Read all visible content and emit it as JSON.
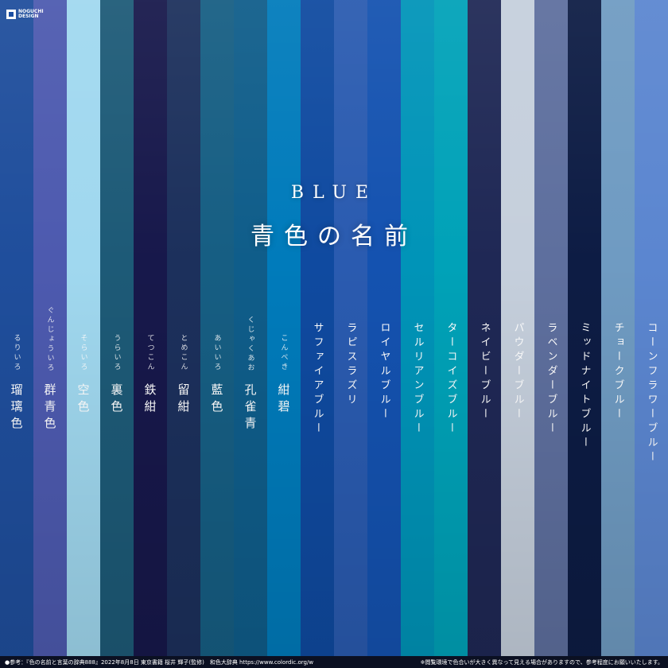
{
  "logo": {
    "line1": "NOGUCHI",
    "line2": "DESIGN"
  },
  "title": {
    "en": "BLUE",
    "jp": "青色の名前"
  },
  "colors": [
    {
      "name": "瑠璃色",
      "ruby": "るりいろ",
      "hex": "#1f4e9c",
      "kind": "kanji"
    },
    {
      "name": "群青色",
      "ruby": "ぐんじょういろ",
      "hex": "#4d5aaf",
      "kind": "kanji"
    },
    {
      "name": "空色",
      "ruby": "そらいろ",
      "hex": "#a0d8ef",
      "kind": "kanji"
    },
    {
      "name": "裏色",
      "ruby": "うらいろ",
      "hex": "#1d5a77",
      "kind": "kanji"
    },
    {
      "name": "鉄紺",
      "ruby": "てつこん",
      "hex": "#17184b",
      "kind": "kanji"
    },
    {
      "name": "留紺",
      "ruby": "とめこん",
      "hex": "#1c305c",
      "kind": "kanji"
    },
    {
      "name": "藍色",
      "ruby": "あいいろ",
      "hex": "#165e83",
      "kind": "kanji"
    },
    {
      "name": "孔雀青",
      "ruby": "くじゃくあお",
      "hex": "#0f5d8a",
      "kind": "kanji"
    },
    {
      "name": "紺碧",
      "ruby": "こんぺき",
      "hex": "#007bbb",
      "kind": "kanji"
    },
    {
      "name": "サファイアブルー",
      "ruby": "",
      "hex": "#0f4aa0",
      "kind": "kata"
    },
    {
      "name": "ラピスラズリ",
      "ruby": "",
      "hex": "#2a5bb0",
      "kind": "kata"
    },
    {
      "name": "ロイヤルブルー",
      "ruby": "",
      "hex": "#1452b0",
      "kind": "kata"
    },
    {
      "name": "セルリアンブルー",
      "ruby": "",
      "hex": "#0094b8",
      "kind": "kata"
    },
    {
      "name": "ターコイズブルー",
      "ruby": "",
      "hex": "#00a2b8",
      "kind": "kata"
    },
    {
      "name": "ネイビーブルー",
      "ruby": "",
      "hex": "#1f2855",
      "kind": "kata"
    },
    {
      "name": "パウダーブルー",
      "ruby": "",
      "hex": "#c5cfdc",
      "kind": "kata"
    },
    {
      "name": "ラベンダーブルー",
      "ruby": "",
      "hex": "#5e6f9e",
      "kind": "kata"
    },
    {
      "name": "ミッドナイトブルー",
      "ruby": "",
      "hex": "#0d1c44",
      "kind": "kata"
    },
    {
      "name": "チョークブルー",
      "ruby": "",
      "hex": "#6f9bc2",
      "kind": "kata"
    },
    {
      "name": "コーンフラワーブルー",
      "ruby": "",
      "hex": "#5b86d0",
      "kind": "kata"
    }
  ],
  "footer": {
    "left": "●参考：『色の名前と言葉の辞典888』2022年8月8日 東京書籍 桜井 輝子(監修)　和色大辞典 https://www.colordic.org/w",
    "right": "※閲覧環境で色合いが大きく異なって見える場合がありますので、参考程度にお願いいたします。"
  }
}
